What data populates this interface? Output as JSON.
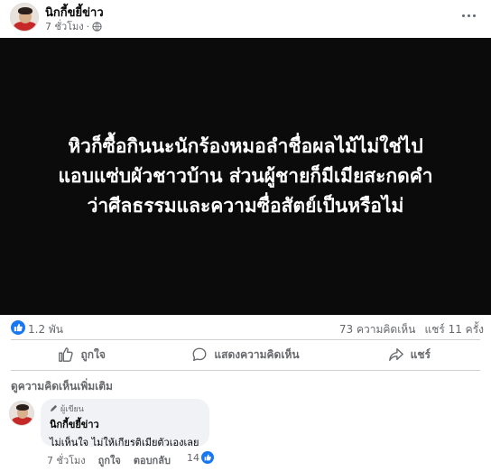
{
  "post": {
    "author": "นิกกี้ขยี้ข่าว",
    "age": "7 ชั่วโมง",
    "separator": "·",
    "privacy_icon": "globe-icon",
    "menu_icon": "more-options-icon"
  },
  "media": {
    "text": "หิวก็ซื้อกินนะนักร้องหมอลำชื่อผลไม้ไม่ใช่ไป\nแอบแซ่บผัวชาวบ้าน ส่วนผู้ชายก็มีเมียสะกดคำ\nว่าศีลธรรมและความซื่อสัตย์เป็นหรือไม่",
    "background": "#0b0b0b"
  },
  "stats": {
    "reactions": "1.2 พัน",
    "comments": "73 ความคิดเห็น",
    "shares": "แชร์ 11 ครั้ง"
  },
  "actions": {
    "like": "ถูกใจ",
    "comment": "แสดงความคิดเห็น",
    "share": "แชร์"
  },
  "comments_section": {
    "see_more": "ดูความคิดเห็นเพิ่มเติม",
    "comment": {
      "badge": "ผู้เขียน",
      "author": "นิกกี้ขยี้ข่าว",
      "text": "ไม่เห็นใจ ไม่ให้เกียรติเมียตัวเองเลย",
      "age": "7 ชั่วโมง",
      "like_label": "ถูกใจ",
      "reply_label": "ตอบกลับ",
      "like_count": "14"
    }
  },
  "colors": {
    "accent": "#1877f2",
    "muted": "#65676b",
    "bubble": "#f0f2f5"
  }
}
